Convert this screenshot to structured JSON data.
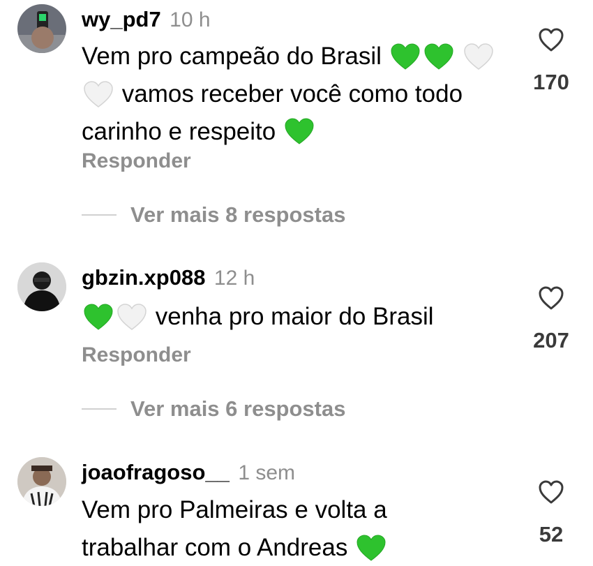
{
  "comments": [
    {
      "username": "wy_pd7",
      "time": "10 h",
      "text_parts": [
        "Vem pro campeão do Brasil",
        "vamos receber você como",
        "todo carinho e respeito"
      ],
      "reply_label": "Responder",
      "like_count": "170",
      "view_more": "Ver mais 8 respostas"
    },
    {
      "username": "gbzin.xp088",
      "time": "12 h",
      "text_parts": [
        "venha pro maior do Brasil"
      ],
      "reply_label": "Responder",
      "like_count": "207",
      "view_more": "Ver mais 6 respostas"
    },
    {
      "username": "joaofragoso__",
      "time": "1 sem",
      "text_parts": [
        "Vem pro Palmeiras e volta a",
        "trabalhar com o Andreas"
      ],
      "like_count": "52"
    }
  ],
  "icons": {
    "like": "heart-outline-icon",
    "emoji_green": "green-heart-emoji",
    "emoji_white": "white-heart-emoji"
  },
  "colors": {
    "green_heart": "#2ec22e",
    "white_heart": "#f0f0f0",
    "muted_text": "#8e8e8e"
  }
}
